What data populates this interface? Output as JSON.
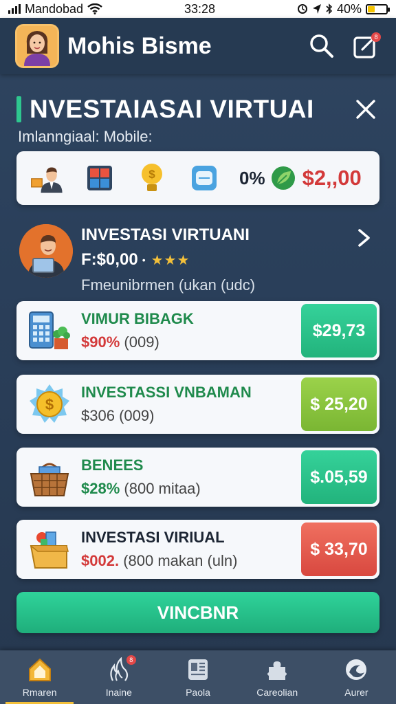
{
  "status_bar": {
    "carrier": "Mandobad",
    "time": "33:28",
    "battery": "40%",
    "battery_level": 0.4
  },
  "header": {
    "title": "Mohis Bisme",
    "notification_count": "8"
  },
  "section": {
    "title": "NVESTAIASAI VIRTUAI",
    "subtitle": "Imlanngiaal: Mobile:"
  },
  "icon_strip": {
    "icons": [
      "businessman-icon",
      "grid-icon",
      "lightbulb-coin-icon",
      "calculator-icon",
      "leaf-icon"
    ],
    "percent": "0%",
    "amount": "$2,,00"
  },
  "feature": {
    "title": "INVESTASI VIRTUANI",
    "price": "F:$0,00",
    "price_dot": "•",
    "stars": "★★★",
    "description": "Fmeunibrmen (ukan (udc)"
  },
  "investments": [
    {
      "title": "VIMUR BIBAGK",
      "value": "$90%",
      "detail": "(009)",
      "price": "$29,73",
      "icon": "calculator-plant-icon",
      "value_color": "#d33a3a",
      "title_color": "green",
      "price_bg": "#2cc88e"
    },
    {
      "title": "INVESTASSI VNBAMAN",
      "value": "$306",
      "detail": "(009)",
      "price": "$ 25,20",
      "icon": "gold-coin-icon",
      "value_color": "#444444",
      "title_color": "green",
      "price_bg": "#8cc43c"
    },
    {
      "title": "BENEES",
      "value": "$28%",
      "detail": "(800 mitaa)",
      "price": "$.05,59",
      "icon": "basket-icon",
      "value_color": "#1f8a4c",
      "title_color": "green",
      "price_bg": "#2cc88e"
    },
    {
      "title": "INVESTASI VIRIUAL",
      "value": "$002.",
      "detail": "(800 makan (uln)",
      "price": "$ 33,70",
      "icon": "box-city-icon",
      "value_color": "#d33a3a",
      "title_color": "dark",
      "price_bg": "#e85a50"
    }
  ],
  "cta": {
    "label": "VINCBNR"
  },
  "bottom_nav": [
    {
      "label": "Rmaren",
      "icon": "home-icon",
      "active": true
    },
    {
      "label": "Inaine",
      "icon": "flame-icon",
      "badge": "8"
    },
    {
      "label": "Paola",
      "icon": "document-icon"
    },
    {
      "label": "Careolian",
      "icon": "puzzle-icon"
    },
    {
      "label": "Aurer",
      "icon": "swirl-icon"
    }
  ],
  "colors": {
    "accent_green": "#2ec78f",
    "price_red": "#d33a3a",
    "star": "#f3c03a"
  }
}
